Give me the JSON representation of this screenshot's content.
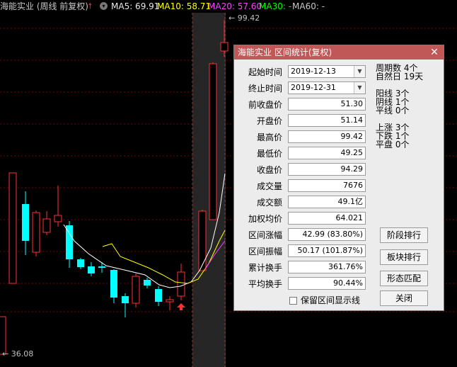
{
  "header": {
    "stock_title": "海能实业 (周线 前复权)",
    "ma5": "MA5: 69.91",
    "ma10": "MA10: 58.71",
    "ma20": "MA20: 57.60",
    "ma30": "MA30: -",
    "ma60": "MA60: -"
  },
  "price_labels": {
    "high": "99.42",
    "low": "36.08"
  },
  "colors": {
    "up": "#ff3030",
    "down": "#00ffff",
    "ma5": "#ffffff",
    "ma10": "#ffff00",
    "ma20": "#ff40ff",
    "ma30": "#00ff00",
    "grid": "#7a0000"
  },
  "dialog": {
    "title": "海能实业 区间统计(复权)",
    "close": "✕",
    "fields": [
      {
        "label": "起始时间",
        "value": "2019-12-13",
        "type": "date"
      },
      {
        "label": "终止时间",
        "value": "2019-12-31",
        "type": "date"
      },
      {
        "label": "前收盘价",
        "value": "51.30"
      },
      {
        "label": "开盘价",
        "value": "51.14"
      },
      {
        "label": "最高价",
        "value": "99.42"
      },
      {
        "label": "最低价",
        "value": "49.25"
      },
      {
        "label": "收盘价",
        "value": "94.29"
      },
      {
        "label": "成交量",
        "value": "7676"
      },
      {
        "label": "成交额",
        "value": "49.1亿"
      },
      {
        "label": "加权均价",
        "value": "64.021"
      },
      {
        "label": "区间涨幅",
        "value": "42.99 (83.80%)"
      },
      {
        "label": "区间振幅",
        "value": "50.17 (101.87%)"
      },
      {
        "label": "累计换手",
        "value": "361.76%"
      },
      {
        "label": "平均换手",
        "value": "90.44%"
      }
    ],
    "stats": [
      {
        "label": "周期数",
        "value": "4个"
      },
      {
        "label": "自然日",
        "value": "19天"
      },
      {
        "label": "阳线",
        "value": "3个"
      },
      {
        "label": "阴线",
        "value": "1个"
      },
      {
        "label": "平线",
        "value": "0个"
      },
      {
        "label": "上涨",
        "value": "3个"
      },
      {
        "label": "下跌",
        "value": "1个"
      },
      {
        "label": "平盘",
        "value": "0个"
      }
    ],
    "buttons": [
      "阶段排行",
      "板块排行",
      "形态匹配",
      "关闭"
    ],
    "checkbox_label": "保留区间显示线"
  }
}
